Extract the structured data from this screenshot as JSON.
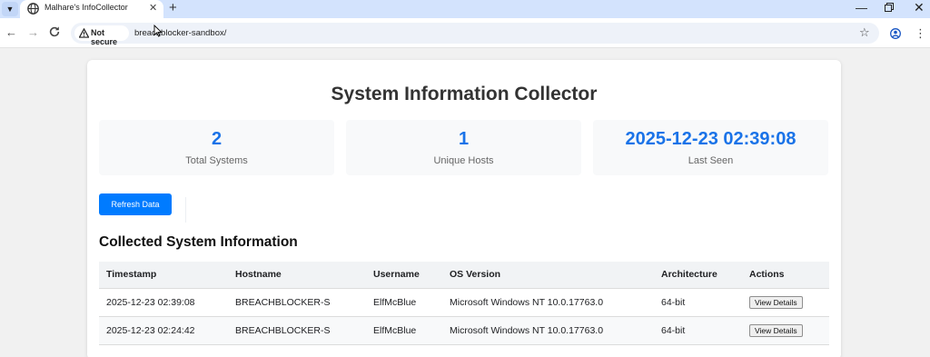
{
  "browser": {
    "tab_title": "Malhare's InfoCollector",
    "security_label": "Not secure",
    "url": "breachblocker-sandbox/"
  },
  "page": {
    "title": "System Information Collector",
    "stats": [
      {
        "value": "2",
        "label": "Total Systems"
      },
      {
        "value": "1",
        "label": "Unique Hosts"
      },
      {
        "value": "2025-12-23 02:39:08",
        "label": "Last Seen"
      }
    ],
    "refresh_label": "Refresh Data",
    "section_title": "Collected System Information",
    "table": {
      "headers": [
        "Timestamp",
        "Hostname",
        "Username",
        "OS Version",
        "Architecture",
        "Actions"
      ],
      "rows": [
        {
          "timestamp": "2025-12-23 02:39:08",
          "hostname": "BREACHBLOCKER-S",
          "username": "ElfMcBlue",
          "os": "Microsoft Windows NT 10.0.17763.0",
          "arch": "64-bit",
          "action": "View Details"
        },
        {
          "timestamp": "2025-12-23 02:24:42",
          "hostname": "BREACHBLOCKER-S",
          "username": "ElfMcBlue",
          "os": "Microsoft Windows NT 10.0.17763.0",
          "arch": "64-bit",
          "action": "View Details"
        }
      ]
    }
  },
  "colors": {
    "accent": "#007bff",
    "stat_value": "#1a73e8",
    "tabstrip": "#d3e3fd"
  },
  "icons": [
    "tab-list-icon",
    "globe-icon",
    "close-icon",
    "plus-icon",
    "minimize-icon",
    "restore-icon",
    "back-icon",
    "forward-icon",
    "reload-icon",
    "warning-icon",
    "star-icon",
    "profile-icon",
    "menu-icon",
    "cursor-icon"
  ]
}
